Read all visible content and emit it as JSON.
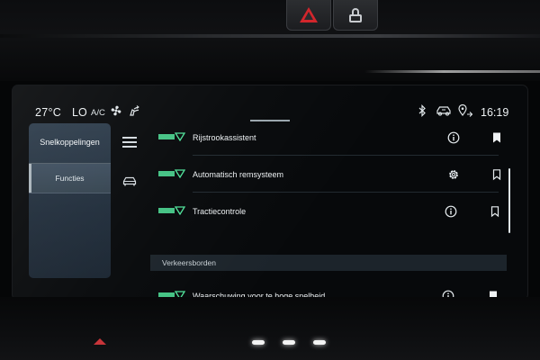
{
  "status_bar": {
    "temperature": "27°C",
    "fan_level": "LO",
    "ac_label": "A/C",
    "time": "16:19",
    "icons": [
      "fan-icon",
      "seat-airflow-icon",
      "bluetooth-icon",
      "car-status-icon",
      "navigation-pin-icon"
    ]
  },
  "shortcut_panel": {
    "title": "Snelkoppelingen",
    "active_tab": "Functies"
  },
  "features": [
    {
      "label": "Rijstrookassistent",
      "action_icon": "info-icon",
      "bookmark_filled": true
    },
    {
      "label": "Automatisch remsysteem",
      "action_icon": "gear-icon",
      "bookmark_filled": false
    },
    {
      "label": "Tractiecontrole",
      "action_icon": "info-icon",
      "bookmark_filled": false
    }
  ],
  "section": {
    "title": "Verkeersborden",
    "items": [
      {
        "label": "Waarschuwing voor te hoge snelheid",
        "action_icon": "info-icon",
        "bookmark_filled": true
      }
    ]
  },
  "colors": {
    "accent_green": "#4fe39a",
    "panel_blue": "#2c3b4a",
    "hazard_red": "#d2262c"
  }
}
